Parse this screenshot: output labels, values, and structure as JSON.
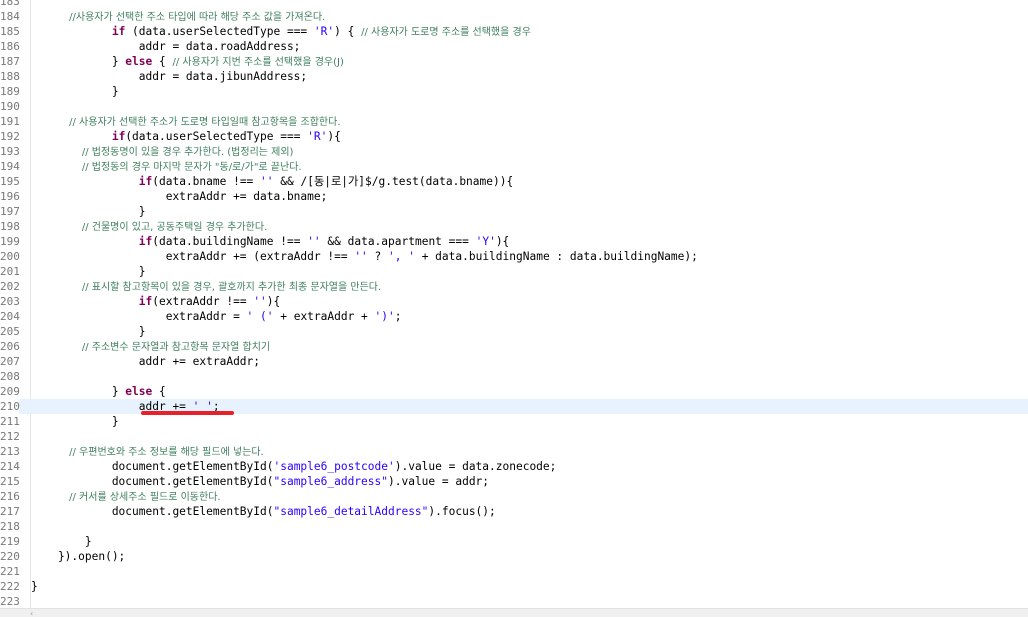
{
  "editor": {
    "current_line": 210,
    "lines": [
      {
        "n": "183",
        "tokens": []
      },
      {
        "n": "184",
        "tokens": [
          {
            "t": "cm",
            "v": "            //사용자가 선택한 주소 타입에 따라 해당 주소 값을 가져온다."
          }
        ]
      },
      {
        "n": "185",
        "tokens": [
          {
            "t": "",
            "v": "            "
          },
          {
            "t": "kw",
            "v": "if"
          },
          {
            "t": "",
            "v": " (data.userSelectedType === "
          },
          {
            "t": "str",
            "v": "'R'"
          },
          {
            "t": "",
            "v": ") { "
          },
          {
            "t": "cm",
            "v": "// 사용자가 도로명 주소를 선택했을 경우"
          }
        ]
      },
      {
        "n": "186",
        "tokens": [
          {
            "t": "",
            "v": "                addr = data.roadAddress;"
          }
        ]
      },
      {
        "n": "187",
        "tokens": [
          {
            "t": "",
            "v": "            } "
          },
          {
            "t": "kw",
            "v": "else"
          },
          {
            "t": "",
            "v": " { "
          },
          {
            "t": "cm",
            "v": "// 사용자가 지번 주소를 선택했을 경우(J)"
          }
        ]
      },
      {
        "n": "188",
        "tokens": [
          {
            "t": "",
            "v": "                addr = data.jibunAddress;"
          }
        ]
      },
      {
        "n": "189",
        "tokens": [
          {
            "t": "",
            "v": "            }"
          }
        ]
      },
      {
        "n": "190",
        "tokens": []
      },
      {
        "n": "191",
        "tokens": [
          {
            "t": "cm",
            "v": "            // 사용자가 선택한 주소가 도로명 타입일때 참고항목을 조합한다."
          }
        ]
      },
      {
        "n": "192",
        "tokens": [
          {
            "t": "",
            "v": "            "
          },
          {
            "t": "kw",
            "v": "if"
          },
          {
            "t": "",
            "v": "(data.userSelectedType === "
          },
          {
            "t": "str",
            "v": "'R'"
          },
          {
            "t": "",
            "v": "){"
          }
        ]
      },
      {
        "n": "193",
        "tokens": [
          {
            "t": "cm",
            "v": "                // 법정동명이 있을 경우 추가한다. (법정리는 제외)"
          }
        ]
      },
      {
        "n": "194",
        "tokens": [
          {
            "t": "cm",
            "v": "                // 법정동의 경우 마지막 문자가 \"동/로/가\"로 끝난다."
          }
        ]
      },
      {
        "n": "195",
        "tokens": [
          {
            "t": "",
            "v": "                "
          },
          {
            "t": "kw",
            "v": "if"
          },
          {
            "t": "",
            "v": "(data.bname !== "
          },
          {
            "t": "str",
            "v": "''"
          },
          {
            "t": "",
            "v": " && /[동|로|가]$/g.test(data.bname)){"
          }
        ]
      },
      {
        "n": "196",
        "tokens": [
          {
            "t": "",
            "v": "                    extraAddr += data.bname;"
          }
        ]
      },
      {
        "n": "197",
        "tokens": [
          {
            "t": "",
            "v": "                }"
          }
        ]
      },
      {
        "n": "198",
        "tokens": [
          {
            "t": "cm",
            "v": "                // 건물명이 있고, 공동주택일 경우 추가한다."
          }
        ]
      },
      {
        "n": "199",
        "tokens": [
          {
            "t": "",
            "v": "                "
          },
          {
            "t": "kw",
            "v": "if"
          },
          {
            "t": "",
            "v": "(data.buildingName !== "
          },
          {
            "t": "str",
            "v": "''"
          },
          {
            "t": "",
            "v": " && data.apartment === "
          },
          {
            "t": "str",
            "v": "'Y'"
          },
          {
            "t": "",
            "v": "){"
          }
        ]
      },
      {
        "n": "200",
        "tokens": [
          {
            "t": "",
            "v": "                    extraAddr += (extraAddr !== "
          },
          {
            "t": "str",
            "v": "''"
          },
          {
            "t": "",
            "v": " ? "
          },
          {
            "t": "str",
            "v": "', '"
          },
          {
            "t": "",
            "v": " + data.buildingName : data.buildingName);"
          }
        ]
      },
      {
        "n": "201",
        "tokens": [
          {
            "t": "",
            "v": "                }"
          }
        ]
      },
      {
        "n": "202",
        "tokens": [
          {
            "t": "cm",
            "v": "                // 표시할 참고항목이 있을 경우, 괄호까지 추가한 최종 문자열을 만든다."
          }
        ]
      },
      {
        "n": "203",
        "tokens": [
          {
            "t": "",
            "v": "                "
          },
          {
            "t": "kw",
            "v": "if"
          },
          {
            "t": "",
            "v": "(extraAddr !== "
          },
          {
            "t": "str",
            "v": "''"
          },
          {
            "t": "",
            "v": "){"
          }
        ]
      },
      {
        "n": "204",
        "tokens": [
          {
            "t": "",
            "v": "                    extraAddr = "
          },
          {
            "t": "str",
            "v": "' ('"
          },
          {
            "t": "",
            "v": " + extraAddr + "
          },
          {
            "t": "str",
            "v": "')'"
          },
          {
            "t": "",
            "v": ";"
          }
        ]
      },
      {
        "n": "205",
        "tokens": [
          {
            "t": "",
            "v": "                }"
          }
        ]
      },
      {
        "n": "206",
        "tokens": [
          {
            "t": "cm",
            "v": "                // 주소변수 문자열과 참고항목 문자열 합치기"
          }
        ]
      },
      {
        "n": "207",
        "tokens": [
          {
            "t": "",
            "v": "                addr += extraAddr;"
          }
        ]
      },
      {
        "n": "208",
        "tokens": []
      },
      {
        "n": "209",
        "tokens": [
          {
            "t": "",
            "v": "            } "
          },
          {
            "t": "kw",
            "v": "else"
          },
          {
            "t": "",
            "v": " {"
          }
        ]
      },
      {
        "n": "210",
        "tokens": [
          {
            "t": "",
            "v": "                addr += "
          },
          {
            "t": "str",
            "v": "' '"
          },
          {
            "t": "",
            "v": ";"
          }
        ]
      },
      {
        "n": "211",
        "tokens": [
          {
            "t": "",
            "v": "            }"
          }
        ]
      },
      {
        "n": "212",
        "tokens": []
      },
      {
        "n": "213",
        "tokens": [
          {
            "t": "cm",
            "v": "            // 우편번호와 주소 정보를 해당 필드에 넣는다."
          }
        ]
      },
      {
        "n": "214",
        "tokens": [
          {
            "t": "",
            "v": "            document.getElementById("
          },
          {
            "t": "str",
            "v": "'sample6_postcode'"
          },
          {
            "t": "",
            "v": ").value = data.zonecode;"
          }
        ]
      },
      {
        "n": "215",
        "tokens": [
          {
            "t": "",
            "v": "            document.getElementById("
          },
          {
            "t": "str",
            "v": "\"sample6_address\""
          },
          {
            "t": "",
            "v": ").value = addr;"
          }
        ]
      },
      {
        "n": "216",
        "tokens": [
          {
            "t": "cm",
            "v": "            // 커서를 상세주소 필드로 이동한다."
          }
        ]
      },
      {
        "n": "217",
        "tokens": [
          {
            "t": "",
            "v": "            document.getElementById("
          },
          {
            "t": "str",
            "v": "\"sample6_detailAddress\""
          },
          {
            "t": "",
            "v": ").focus();"
          }
        ]
      },
      {
        "n": "218",
        "tokens": []
      },
      {
        "n": "219",
        "tokens": [
          {
            "t": "",
            "v": "        }"
          }
        ]
      },
      {
        "n": "220",
        "tokens": [
          {
            "t": "",
            "v": "    }).open();"
          }
        ]
      },
      {
        "n": "221",
        "tokens": []
      },
      {
        "n": "222",
        "tokens": [
          {
            "t": "",
            "v": "}"
          }
        ]
      },
      {
        "n": "223",
        "tokens": []
      }
    ]
  },
  "annotation": {
    "color": "#e8202a",
    "target_line": 210
  },
  "scrollbar": {
    "left_arrow": "‹"
  }
}
